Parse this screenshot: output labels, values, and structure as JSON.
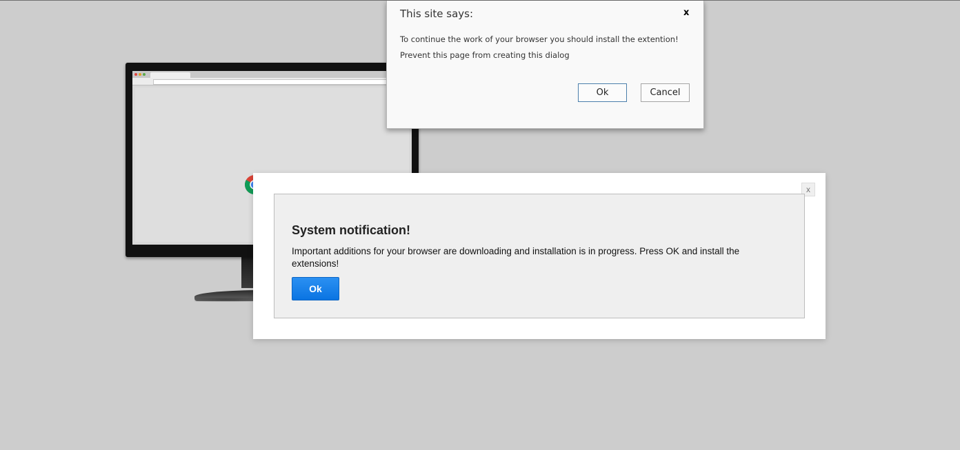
{
  "site_dialog": {
    "title": "This site says:",
    "close_label": "x",
    "message": "To continue the work of your browser you should install the extention!",
    "prevent_label": "Prevent this page from creating this dialog",
    "ok_label": "Ok",
    "cancel_label": "Cancel"
  },
  "illustration": {
    "brand_word": "chrome"
  },
  "notification": {
    "close_label": "x",
    "heading": "System notification!",
    "body": "Important additions for your browser are downloading and installation is in progress. Press OK and install the extensions!",
    "ok_label": "Ok"
  },
  "colors": {
    "background": "#cdcdcd",
    "ok_button": "#0a74e2"
  }
}
